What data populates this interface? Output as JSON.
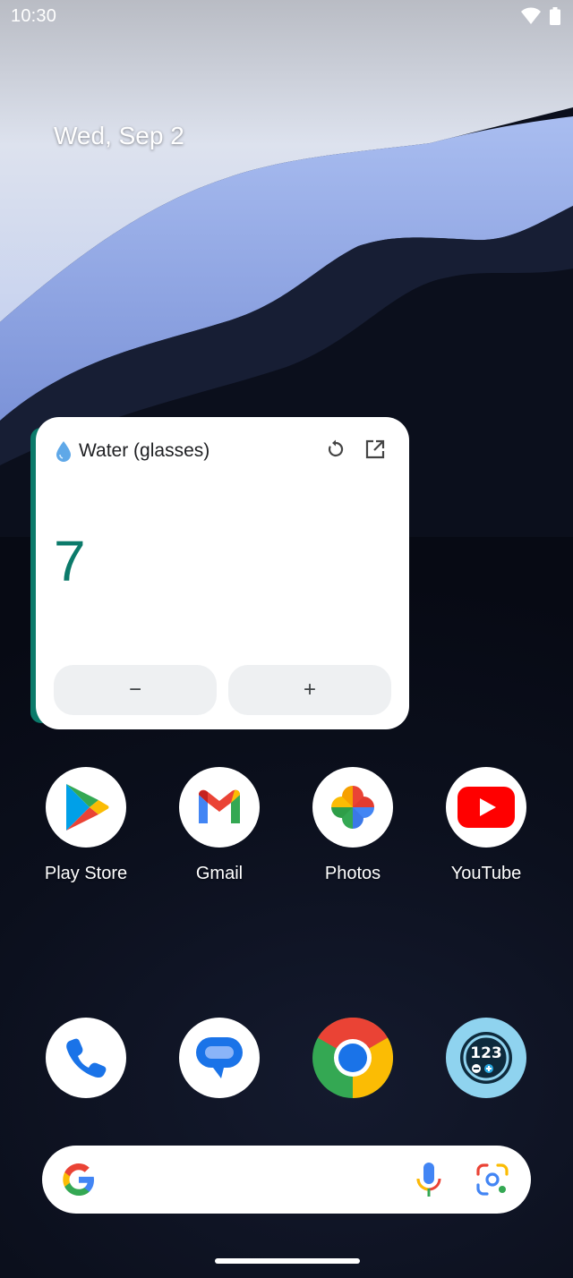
{
  "status_bar": {
    "time": "10:30",
    "icons": [
      "wifi-icon",
      "battery-icon"
    ]
  },
  "home": {
    "date": "Wed, Sep 2"
  },
  "widget": {
    "title": "Water (glasses)",
    "value": "7",
    "minus_label": "−",
    "plus_label": "+",
    "accent_color": "#0b7a6a",
    "icons": [
      "water-drop-icon",
      "refresh-icon",
      "open-external-icon"
    ]
  },
  "apps_row": [
    {
      "label": "Play Store",
      "icon": "play-store-icon"
    },
    {
      "label": "Gmail",
      "icon": "gmail-icon"
    },
    {
      "label": "Photos",
      "icon": "photos-icon"
    },
    {
      "label": "YouTube",
      "icon": "youtube-icon"
    }
  ],
  "dock": [
    {
      "icon": "phone-icon"
    },
    {
      "icon": "messages-icon"
    },
    {
      "icon": "chrome-icon"
    },
    {
      "icon": "counter-app-icon",
      "badge_text": "123"
    }
  ],
  "search_bar": {
    "icons": [
      "google-g-icon",
      "microphone-icon",
      "google-lens-icon"
    ]
  }
}
